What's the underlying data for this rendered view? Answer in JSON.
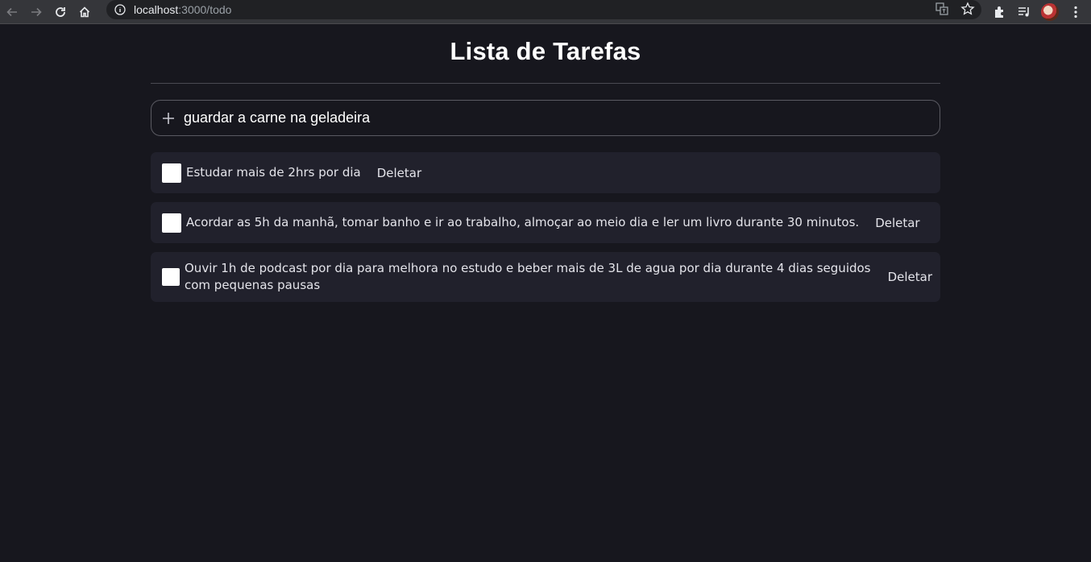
{
  "browser": {
    "url_host": "localhost",
    "url_path": ":3000/todo"
  },
  "page": {
    "title": "Lista de Tarefas"
  },
  "new_todo": {
    "value": "guardar a carne na geladeira"
  },
  "todos": [
    {
      "text": "Estudar mais de 2hrs por dia",
      "delete_label": "Deletar",
      "checked": false
    },
    {
      "text": "Acordar as 5h da manhã, tomar banho e ir ao trabalho, almoçar ao meio dia e ler um livro durante 30 minutos.",
      "delete_label": "Deletar",
      "checked": false
    },
    {
      "text": "Ouvir 1h de podcast por dia para melhora no estudo e beber mais de 3L de agua por dia durante 4 dias seguidos com pequenas pausas",
      "delete_label": "Deletar",
      "checked": false
    }
  ],
  "colors": {
    "background": "#17171e",
    "item_background": "#21212c",
    "text": "#e4e4ea"
  }
}
